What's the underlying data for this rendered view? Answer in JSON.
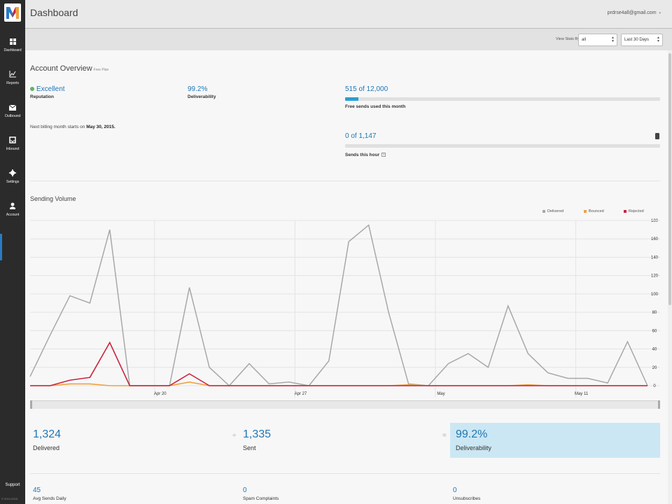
{
  "header": {
    "title": "Dashboard",
    "user_email": "prdrse4all@gmail.com",
    "user_menu_arrow": "chevron-down-icon"
  },
  "sidebar": {
    "items": [
      {
        "label": "Dashboard",
        "icon": "grid-icon"
      },
      {
        "label": "Reports",
        "icon": "chart-icon"
      },
      {
        "label": "Outbound",
        "icon": "envelope-icon"
      },
      {
        "label": "Inbound",
        "icon": "inbox-icon"
      },
      {
        "label": "Settings",
        "icon": "gear-icon"
      },
      {
        "label": "Account",
        "icon": "user-icon"
      }
    ],
    "support_label": "Support"
  },
  "filters": {
    "view_stats_by_label": "View Stats By:",
    "view_stats_value": "all",
    "period_value": "Last 30 Days"
  },
  "overview": {
    "title": "Account Overview",
    "plan": "Free Plan",
    "reputation_value": "Excellent",
    "reputation_label": "Reputation",
    "deliverability_value": "99.2%",
    "deliverability_label": "Deliverability",
    "billing_note_prefix": "Next billing month starts on",
    "billing_date": "May 30, 2015.",
    "free_sends_value": "515 of 12,000",
    "free_sends_label": "Free sends used this month",
    "free_sends_fraction": 0.043,
    "hour_sends_value": "0 of 1,147",
    "hour_sends_label": "Sends this hour",
    "hour_sends_fraction": 0
  },
  "colors": {
    "sidebar_bg": "#2b2b2b",
    "accent_blue": "#2177b2",
    "delivered": "#a8a8a8",
    "bounced": "#f0a040",
    "rejected": "#c9243a",
    "highlight": "#cbe7f3"
  },
  "chart_data": {
    "type": "line",
    "title": "Sending Volume",
    "x_tick_labels": [
      "Apr 20",
      "Apr 27",
      "May",
      "May 11"
    ],
    "ylim": [
      0,
      180
    ],
    "y_ticks": [
      "0",
      "20",
      "40",
      "60",
      "80",
      "100",
      "120",
      "140",
      "160",
      "180"
    ],
    "y_tick_display": [
      "0",
      "20",
      "40",
      "60",
      "80",
      "100",
      "120",
      "140",
      "160",
      "180"
    ],
    "grid": true,
    "legend_position": "top-right",
    "series": [
      {
        "name": "Delivered",
        "values": [
          10,
          55,
          98,
          90,
          170,
          0,
          0,
          0,
          107,
          20,
          0,
          24,
          2,
          4,
          0,
          27,
          157,
          175,
          80,
          2,
          0,
          24,
          35,
          20,
          87,
          35,
          14,
          8,
          8,
          3,
          48,
          0
        ]
      },
      {
        "name": "Bounced",
        "values": [
          0,
          0,
          2,
          2,
          0,
          0,
          0,
          0,
          4,
          0,
          0,
          0,
          0,
          0,
          0,
          0,
          0,
          0,
          0,
          1,
          0,
          0,
          0,
          0,
          0,
          1,
          0,
          0,
          0,
          0,
          0,
          0
        ]
      },
      {
        "name": "Rejected",
        "values": [
          0,
          0,
          6,
          9,
          47,
          0,
          0,
          0,
          13,
          0,
          0,
          0,
          0,
          0,
          0,
          0,
          0,
          0,
          0,
          0,
          0,
          0,
          0,
          0,
          0,
          0,
          0,
          0,
          0,
          0,
          0,
          0
        ]
      }
    ]
  },
  "stats": {
    "delivered_value": "1,324",
    "delivered_label": "Delivered",
    "divide_op": "÷",
    "sent_value": "1,335",
    "sent_label": "Sent",
    "equals_op": "=",
    "deliverability_value": "99.2%",
    "deliverability_label": "Deliverability",
    "avg_sends_value": "45",
    "avg_sends_label": "Avg Sends Daily",
    "spam_value": "0",
    "spam_label": "Spam Complaints",
    "unsub_value": "0",
    "unsub_label": "Unsubscribes"
  }
}
